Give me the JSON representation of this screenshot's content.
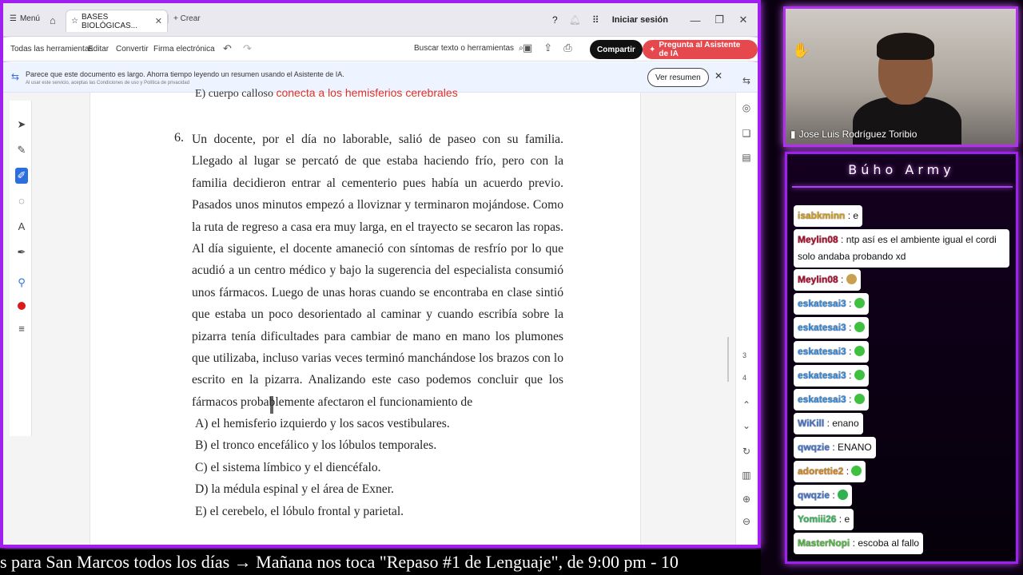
{
  "titlebar": {
    "menu_label": "Menú",
    "tab_title": "BASES BIOLÓGICAS...",
    "new_tab_label": "+ Crear",
    "login_label": "Iniciar sesión"
  },
  "toolbar": {
    "items": [
      "Todas las herramientas",
      "Editar",
      "Convertir",
      "Firma electrónica"
    ],
    "search_label": "Buscar texto o herramientas",
    "share_label": "Compartir",
    "ai_label": "Pregunta al Asistente de IA"
  },
  "banner": {
    "text": "Parece que este documento es largo. Ahorra tiempo leyendo un resumen usando el Asistente de IA.",
    "subtext": "Al usar este servicio, aceptas las Condiciones de uso y Política de privacidad",
    "button_label": "Ver resumen"
  },
  "document": {
    "prev_option_prefix": "E)  cuerpo calloso",
    "prev_option_red": "conecta a los hemisferios cerebrales",
    "question_number": "6.",
    "question_text": "Un docente, por el día no laborable, salió de paseo con su familia. Llegado al lugar se percató de que estaba haciendo frío, pero con la familia decidieron entrar al cementerio pues había un acuerdo previo. Pasados unos minutos empezó a lloviznar y terminaron mojándose. Como la ruta de regreso a casa era muy larga, en el trayecto se secaron las ropas. Al día siguiente, el docente amaneció con síntomas de resfrío por lo que acudió a un centro médico y bajo la sugerencia del especialista consumió unos fármacos. Luego de unas horas cuando se encontraba en clase sintió que estaba un poco desorientado al caminar y cuando escribía sobre la pizarra tenía dificultades para cambiar de mano en mano los plumones que utilizaba, incluso varias veces terminó manchándose los brazos con lo escrito en la pizarra. Analizando este caso podemos concluir que los fármacos probablemente afectaron el funcionamiento de",
    "options": [
      "A)  el hemisferio izquierdo y los sacos vestibulares.",
      "B)  el tronco encefálico y los lóbulos temporales.",
      "C)  el sistema límbico y el diencéfalo.",
      "D)  la médula espinal y el área de Exner.",
      "E)  el cerebelo, el lóbulo frontal y parietal."
    ],
    "page_current": "3",
    "page_total": "4"
  },
  "ticker": {
    "text": "s para San Marcos todos los días  →  Mañana nos toca \"Repaso #1 de Lenguaje\", de 9:00 pm - 10"
  },
  "webcam": {
    "name": "Jose Luis Rodríguez Toribio"
  },
  "chat": {
    "title": "Búho Army",
    "messages": [
      {
        "user": "isabkminn",
        "color": "#d4a020",
        "text": "e",
        "emoji": ""
      },
      {
        "user": "Meylin08",
        "color": "#b01030",
        "text": "ntp así es el ambiente igual el cordi solo andaba probando xd",
        "emoji": ""
      },
      {
        "user": "Meylin08",
        "color": "#b01030",
        "text": "",
        "emoji": "#c8a050"
      },
      {
        "user": "eskatesai3",
        "color": "#3a8ee0",
        "text": "",
        "emoji": "#40c040"
      },
      {
        "user": "eskatesai3",
        "color": "#3a8ee0",
        "text": "",
        "emoji": "#40c040"
      },
      {
        "user": "eskatesai3",
        "color": "#3a8ee0",
        "text": "",
        "emoji": "#40c040"
      },
      {
        "user": "eskatesai3",
        "color": "#3a8ee0",
        "text": "",
        "emoji": "#40c040"
      },
      {
        "user": "eskatesai3",
        "color": "#3a8ee0",
        "text": "",
        "emoji": "#40c040"
      },
      {
        "user": "WiKill",
        "color": "#4a78d0",
        "text": "enano",
        "emoji": ""
      },
      {
        "user": "qwqzie",
        "color": "#4a78d0",
        "text": "ENANO",
        "emoji": ""
      },
      {
        "user": "adorettie2",
        "color": "#d88a20",
        "text": "",
        "emoji": "#40c040"
      },
      {
        "user": "qwqzie",
        "color": "#4a78d0",
        "text": "",
        "emoji": "#30b050"
      },
      {
        "user": "Yomiii26",
        "color": "#40b860",
        "text": "e",
        "emoji": ""
      },
      {
        "user": "MasterNopi",
        "color": "#58b848",
        "text": "escoba al fallo",
        "emoji": ""
      }
    ]
  },
  "colors": {
    "neon_border": "#a020f0",
    "ai_button": "#e5484d",
    "share_button": "#111111",
    "highlight_red": "#e0302a",
    "active_tool": "#2b6ee0"
  }
}
